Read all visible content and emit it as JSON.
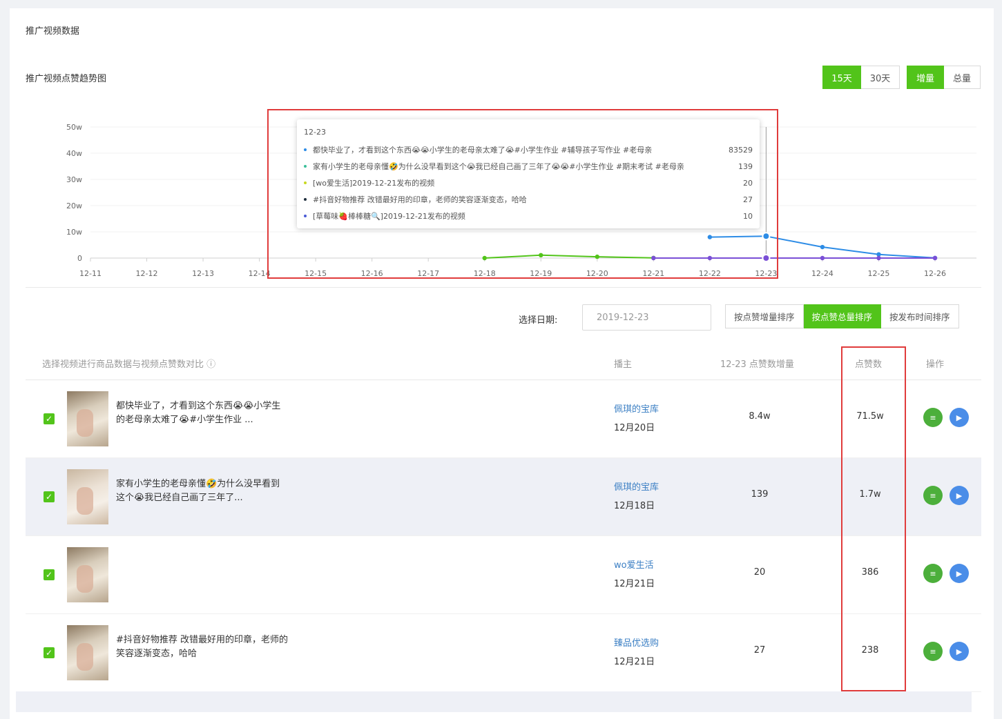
{
  "page": {
    "section_title": "推广视频数据",
    "chart_title": "推广视频点赞趋势图"
  },
  "controls": {
    "range_options": [
      "15天",
      "30天"
    ],
    "range_active": "15天",
    "mode_options": [
      "增量",
      "总量"
    ],
    "mode_active": "增量",
    "date_label": "选择日期:",
    "date_value": "2019-12-23",
    "sort_options": [
      "按点赞增量排序",
      "按点赞总量排序",
      "按发布时间排序"
    ],
    "sort_active": "按点赞总量排序"
  },
  "chart_data": {
    "type": "line",
    "x": [
      "12-11",
      "12-12",
      "12-13",
      "12-14",
      "12-15",
      "12-16",
      "12-17",
      "12-18",
      "12-19",
      "12-20",
      "12-21",
      "12-22",
      "12-23",
      "12-24",
      "12-25",
      "12-26"
    ],
    "ylim": [
      0,
      500000
    ],
    "y_ticks": [
      "0",
      "10w",
      "20w",
      "30w",
      "40w",
      "50w"
    ],
    "y_tick_values": [
      0,
      100000,
      200000,
      300000,
      400000,
      500000
    ],
    "series": [
      {
        "color": "#2d8ce6",
        "values": [
          null,
          null,
          null,
          null,
          null,
          null,
          null,
          null,
          null,
          null,
          null,
          80000,
          83529,
          42000,
          14000,
          500
        ]
      },
      {
        "color": "#52c41a",
        "values": [
          null,
          null,
          null,
          null,
          null,
          null,
          null,
          0,
          11000,
          5000,
          500,
          null,
          null,
          null,
          null,
          null
        ]
      },
      {
        "color": "#7a4fd6",
        "values": [
          null,
          null,
          null,
          null,
          null,
          null,
          null,
          null,
          null,
          null,
          0,
          0,
          0,
          0,
          0,
          0
        ]
      }
    ],
    "tooltip": {
      "date": "12-23",
      "items": [
        {
          "color": "#2d8ce6",
          "name": "都快毕业了，才看到这个东西😭😭小学生的老母亲太难了😭#小学生作业 #辅导孩子写作业 #老母亲",
          "value": "83529"
        },
        {
          "color": "#3bbf9a",
          "name": "家有小学生的老母亲懂🤣为什么没早看到这个😭我已经自己画了三年了😭😭#小学生作业 #期末考试 #老母亲",
          "value": "139"
        },
        {
          "color": "#c8d820",
          "name": "[wo爱生活]2019-12-21发布的视频",
          "value": "20"
        },
        {
          "color": "#1f2d3d",
          "name": "#抖音好物推荐 改错最好用的印章，老师的笑容逐渐变态，哈哈",
          "value": "27"
        },
        {
          "color": "#4a5bd6",
          "name": "[草莓味🍓棒棒糖🔍]2019-12-21发布的视频",
          "value": "10"
        }
      ]
    }
  },
  "table": {
    "headers": {
      "select": "选择视频进行商品数据与视频点赞数对比 ⓘ",
      "owner": "播主",
      "increment": "12-23 点赞数增量",
      "total": "点赞数",
      "ops": "操作"
    },
    "rows": [
      {
        "checked": "✓",
        "title": "都快毕业了，才看到这个东西😭😭小学生的老母亲太难了😭#小学生作业 ...",
        "owner": "佩琪的宝库",
        "date": "12月20日",
        "increment": "8.4w",
        "total": "71.5w"
      },
      {
        "checked": "✓",
        "title": "家有小学生的老母亲懂🤣为什么没早看到这个😭我已经自己画了三年了...",
        "owner": "佩琪的宝库",
        "date": "12月18日",
        "increment": "139",
        "total": "1.7w"
      },
      {
        "checked": "✓",
        "title": "",
        "owner": "wo爱生活",
        "date": "12月21日",
        "increment": "20",
        "total": "386"
      },
      {
        "checked": "✓",
        "title": "#抖音好物推荐 改错最好用的印章，老师的笑容逐渐变态，哈哈",
        "owner": "臻品优选购",
        "date": "12月21日",
        "increment": "27",
        "total": "238"
      }
    ]
  },
  "icons": {
    "detail": "list-icon",
    "play": "play-icon",
    "play_glyph": "▶",
    "detail_glyph": "≡"
  }
}
